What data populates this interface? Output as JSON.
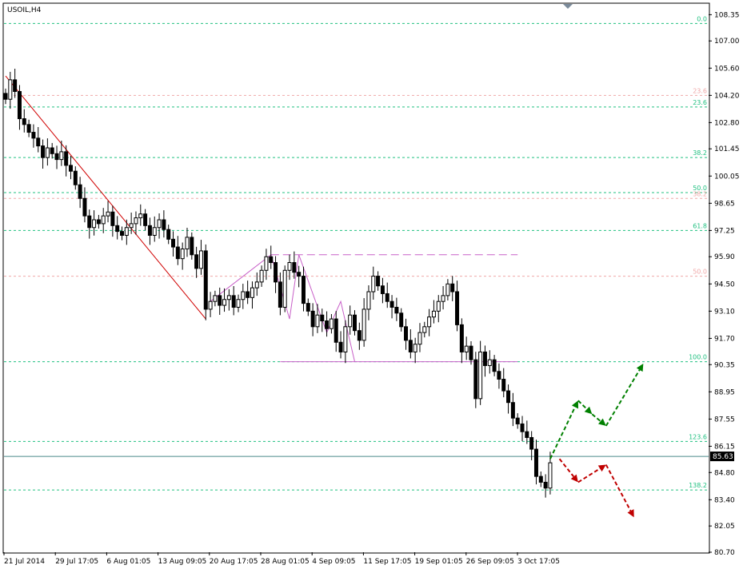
{
  "symbol_label": "USOIL,H4",
  "current_price_label": "85.63",
  "colors": {
    "fib_green": "#20c080",
    "fib_pink": "#f0a8a8",
    "trend_red": "#d00000",
    "channel_magenta": "#c860c8",
    "bull_arrow": "#008000",
    "bear_arrow": "#c00000",
    "candle": "#000000",
    "price_line": "#4a8a8a"
  },
  "chart_data": {
    "type": "candlestick",
    "symbol": "USOIL",
    "timeframe": "H4",
    "ylim": [
      80.7,
      108.9
    ],
    "price_ticks": [
      "108.35",
      "107.00",
      "105.60",
      "104.20",
      "102.80",
      "101.45",
      "100.05",
      "98.65",
      "97.25",
      "95.90",
      "94.50",
      "93.10",
      "91.70",
      "90.35",
      "88.95",
      "87.55",
      "86.15",
      "84.80",
      "83.40",
      "82.05",
      "80.70"
    ],
    "time_ticks": [
      "21 Jul 2014",
      "29 Jul 17:05",
      "6 Aug 01:05",
      "13 Aug 09:05",
      "20 Aug 17:05",
      "28 Aug 01:05",
      "4 Sep 09:05",
      "11 Sep 17:05",
      "19 Sep 01:05",
      "26 Sep 09:05",
      "3 Oct 17:05"
    ],
    "close_series": [
      104.0,
      105.0,
      104.4,
      103.0,
      102.7,
      102.3,
      102.0,
      101.6,
      101.0,
      101.5,
      101.2,
      100.9,
      101.3,
      100.6,
      100.3,
      99.6,
      98.9,
      98.0,
      97.4,
      97.8,
      97.6,
      98.0,
      98.2,
      97.5,
      97.2,
      97.0,
      97.4,
      97.6,
      97.9,
      98.1,
      97.5,
      97.0,
      97.4,
      97.8,
      97.3,
      96.8,
      96.4,
      95.8,
      96.3,
      96.9,
      96.0,
      95.3,
      96.2,
      93.2,
      93.6,
      93.9,
      93.4,
      93.7,
      93.9,
      93.3,
      93.7,
      94.1,
      93.8,
      94.3,
      94.6,
      95.2,
      95.9,
      95.6,
      94.6,
      93.3,
      95.2,
      95.6,
      95.1,
      94.9,
      93.5,
      93.1,
      92.3,
      92.9,
      92.6,
      92.2,
      92.7,
      91.5,
      91.0,
      92.3,
      92.9,
      92.1,
      91.6,
      93.2,
      94.1,
      94.9,
      94.4,
      94.0,
      93.6,
      93.3,
      93.0,
      92.3,
      91.6,
      91.0,
      91.4,
      92.0,
      92.3,
      92.8,
      93.1,
      93.6,
      93.9,
      94.5,
      94.1,
      92.4,
      91.0,
      91.3,
      90.6,
      88.6,
      91.0,
      90.3,
      90.6,
      90.0,
      89.6,
      89.0,
      88.4,
      87.6,
      87.3,
      86.9,
      86.6,
      86.0,
      84.6,
      84.3,
      84.0,
      85.3
    ],
    "fibonacci_levels": [
      {
        "label": "0.0",
        "price": 107.9
      },
      {
        "label": "23.6",
        "price": 103.6
      },
      {
        "label": "38.2",
        "price": 101.0
      },
      {
        "label": "50.0",
        "price": 99.2
      },
      {
        "label": "61.8",
        "price": 97.25
      },
      {
        "label": "100.0",
        "price": 90.5
      },
      {
        "label": "123.6",
        "price": 86.4
      },
      {
        "label": "138.2",
        "price": 83.9
      }
    ],
    "fibonacci_levels_secondary": [
      {
        "label": "23.6",
        "price": 104.2
      },
      {
        "label": "38.2",
        "price": 98.9
      },
      {
        "label": "50.0",
        "price": 94.9
      }
    ],
    "current_price": 85.63,
    "annotations": {
      "trendline": {
        "from": [
          0,
          105.2
        ],
        "to": [
          43,
          92.7
        ]
      },
      "channel_top_dashed": {
        "from": [
          57,
          96.0
        ],
        "to": [
          110,
          96.0
        ]
      },
      "channel_bottom": {
        "from": [
          59,
          90.5
        ],
        "to": [
          110,
          90.5
        ]
      },
      "zigzag": [
        [
          44,
          93.6
        ],
        [
          57,
          96.0
        ],
        [
          61,
          92.7
        ],
        [
          63,
          96.0
        ],
        [
          69,
          92.0
        ],
        [
          72,
          93.6
        ],
        [
          75,
          90.5
        ]
      ],
      "forecast_bullish": [
        [
          117,
          85.5
        ],
        [
          123,
          88.5
        ],
        [
          126,
          87.8
        ],
        [
          129,
          87.2
        ],
        [
          137,
          90.4
        ]
      ],
      "forecast_bearish": [
        [
          119,
          85.5
        ],
        [
          123,
          84.3
        ],
        [
          129,
          85.2
        ],
        [
          135,
          82.5
        ]
      ]
    }
  }
}
